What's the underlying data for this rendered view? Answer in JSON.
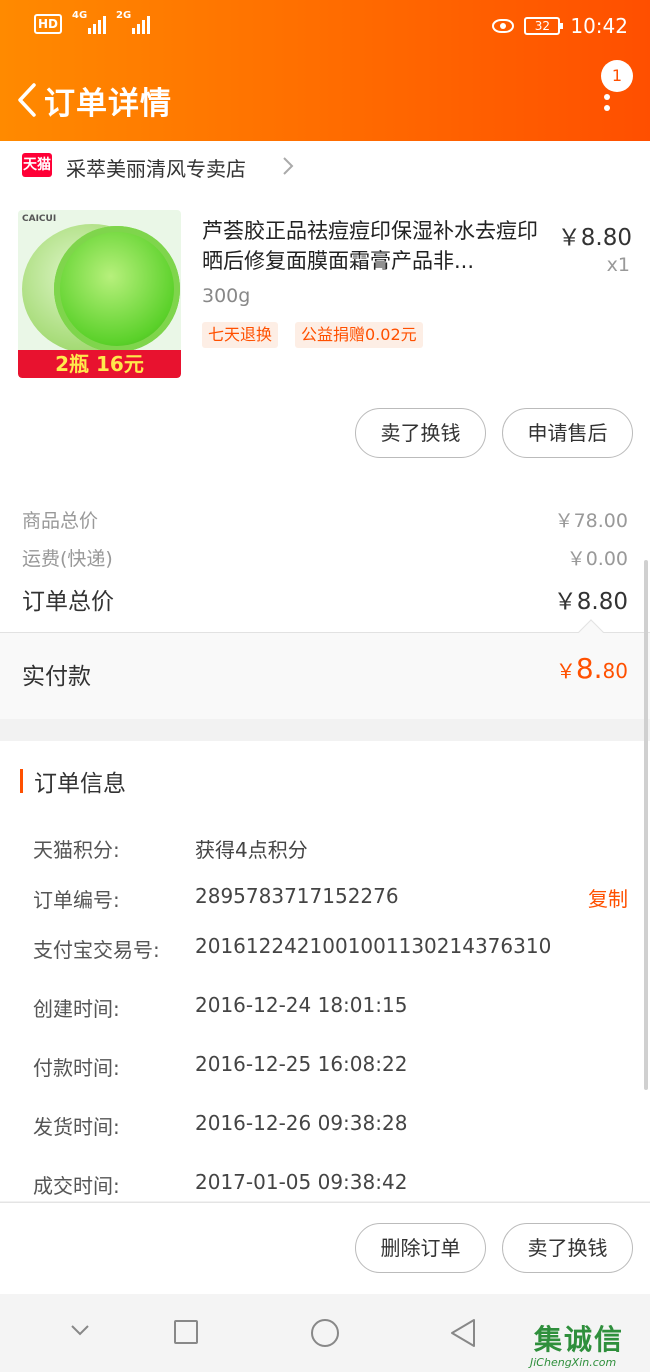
{
  "statusbar": {
    "hd": "HD",
    "net1": "4G",
    "net2": "2G",
    "battery": "32",
    "time": "10:42"
  },
  "nav": {
    "title": "订单详情",
    "badge": "1"
  },
  "shop": {
    "platform": "天猫",
    "name": "采萃美丽清风专卖店"
  },
  "product": {
    "brand": "CAICUI",
    "title": "芦荟胶正品祛痘痘印保湿补水去痘印晒后修复面膜面霜膏产品非...",
    "spec": "300g",
    "price": "￥8.80",
    "qty": "x1",
    "promo": "2瓶 16元",
    "tags": [
      "七天退换",
      "公益捐赠0.02元"
    ]
  },
  "actions_top": {
    "sell": "卖了换钱",
    "aftersale": "申请售后"
  },
  "price": {
    "goods_label": "商品总价",
    "goods_value": "￥78.00",
    "ship_label": "运费(快递)",
    "ship_value": "￥0.00",
    "total_label": "订单总价",
    "total_value": "￥8.80",
    "paid_label": "实付款",
    "paid_currency": "￥",
    "paid_int": "8.",
    "paid_dec": "80"
  },
  "order_info": {
    "title": "订单信息",
    "copy": "复制",
    "rows": [
      {
        "label": "天猫积分:",
        "value": "获得4点积分"
      },
      {
        "label": "订单编号:",
        "value": "2895783717152276"
      },
      {
        "label": "支付宝交易号:",
        "value": "2016122421001001130214376310"
      },
      {
        "label": "创建时间:",
        "value": "2016-12-24 18:01:15"
      },
      {
        "label": "付款时间:",
        "value": "2016-12-25 16:08:22"
      },
      {
        "label": "发货时间:",
        "value": "2016-12-26 09:38:28"
      },
      {
        "label": "成交时间:",
        "value": "2017-01-05 09:38:42"
      }
    ]
  },
  "actions_bottom": {
    "delete": "删除订单",
    "sell": "卖了换钱"
  },
  "watermark": {
    "main": "集诚信",
    "sub": "JiChengXin.com"
  }
}
